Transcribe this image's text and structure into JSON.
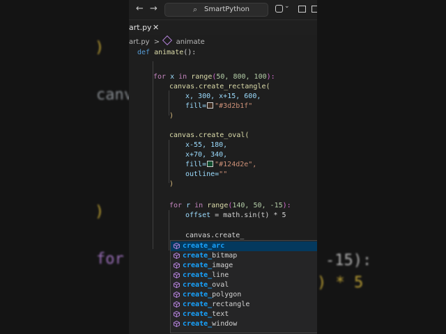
{
  "titlebar": {
    "back": "←",
    "forward": "→",
    "search_label": "SmartPython"
  },
  "tab": {
    "label": "art.py",
    "close": "✕"
  },
  "breadcrumb": {
    "file": "art.py",
    "separator": ">",
    "symbol": "animate"
  },
  "code": {
    "def_kw": "def",
    "def_name": "animate",
    "def_rest": "():",
    "for1_kw": "for",
    "for1_var": "x",
    "for1_in": "in",
    "for1_fn": "range",
    "for1_args": "50, 800, 100",
    "rect_call": "canvas.create_rectangle(",
    "rect_args1": "x, 300, x+15, 600,",
    "rect_fill_key": "fill=",
    "rect_fill_val": "\"#3d2b1f\"",
    "close1": ")",
    "oval_call": "canvas.create_oval(",
    "oval_args1": "x-55, 180,",
    "oval_args2": "x+70, 340,",
    "oval_fill_key": "fill=",
    "oval_fill_val": "\"#124d2e\",",
    "oval_outline_key": "outline=",
    "oval_outline_val": "\"\"",
    "close2": ")",
    "for2_kw": "for",
    "for2_var": "r",
    "for2_in": "in",
    "for2_fn": "range",
    "for2_args": "140, 50, -15",
    "offset_var": "offset",
    "offset_rest": " = math.sin(t) * 5",
    "typing": "canvas.create_"
  },
  "autocomplete": {
    "prefix": "create_",
    "items": [
      "arc",
      "bitmap",
      "image",
      "line",
      "oval",
      "polygon",
      "rectangle",
      "text",
      "window"
    ],
    "selected_index": 0
  },
  "background": {
    "left_lines": [
      ")",
      "canv",
      ")",
      "for"
    ],
    "right_lines": [
      "-15):",
      ") * 5"
    ]
  },
  "colors": {
    "keyword": "#569cd6",
    "function": "#dcdcaa",
    "string": "#ce9178",
    "number": "#b5cea8",
    "selection": "#04395e",
    "match_highlight": "#18a3ff",
    "icon_purple": "#b180d7"
  },
  "swatches": {
    "rect_fill": "#3d2b1f",
    "oval_fill": "#124d2e"
  }
}
